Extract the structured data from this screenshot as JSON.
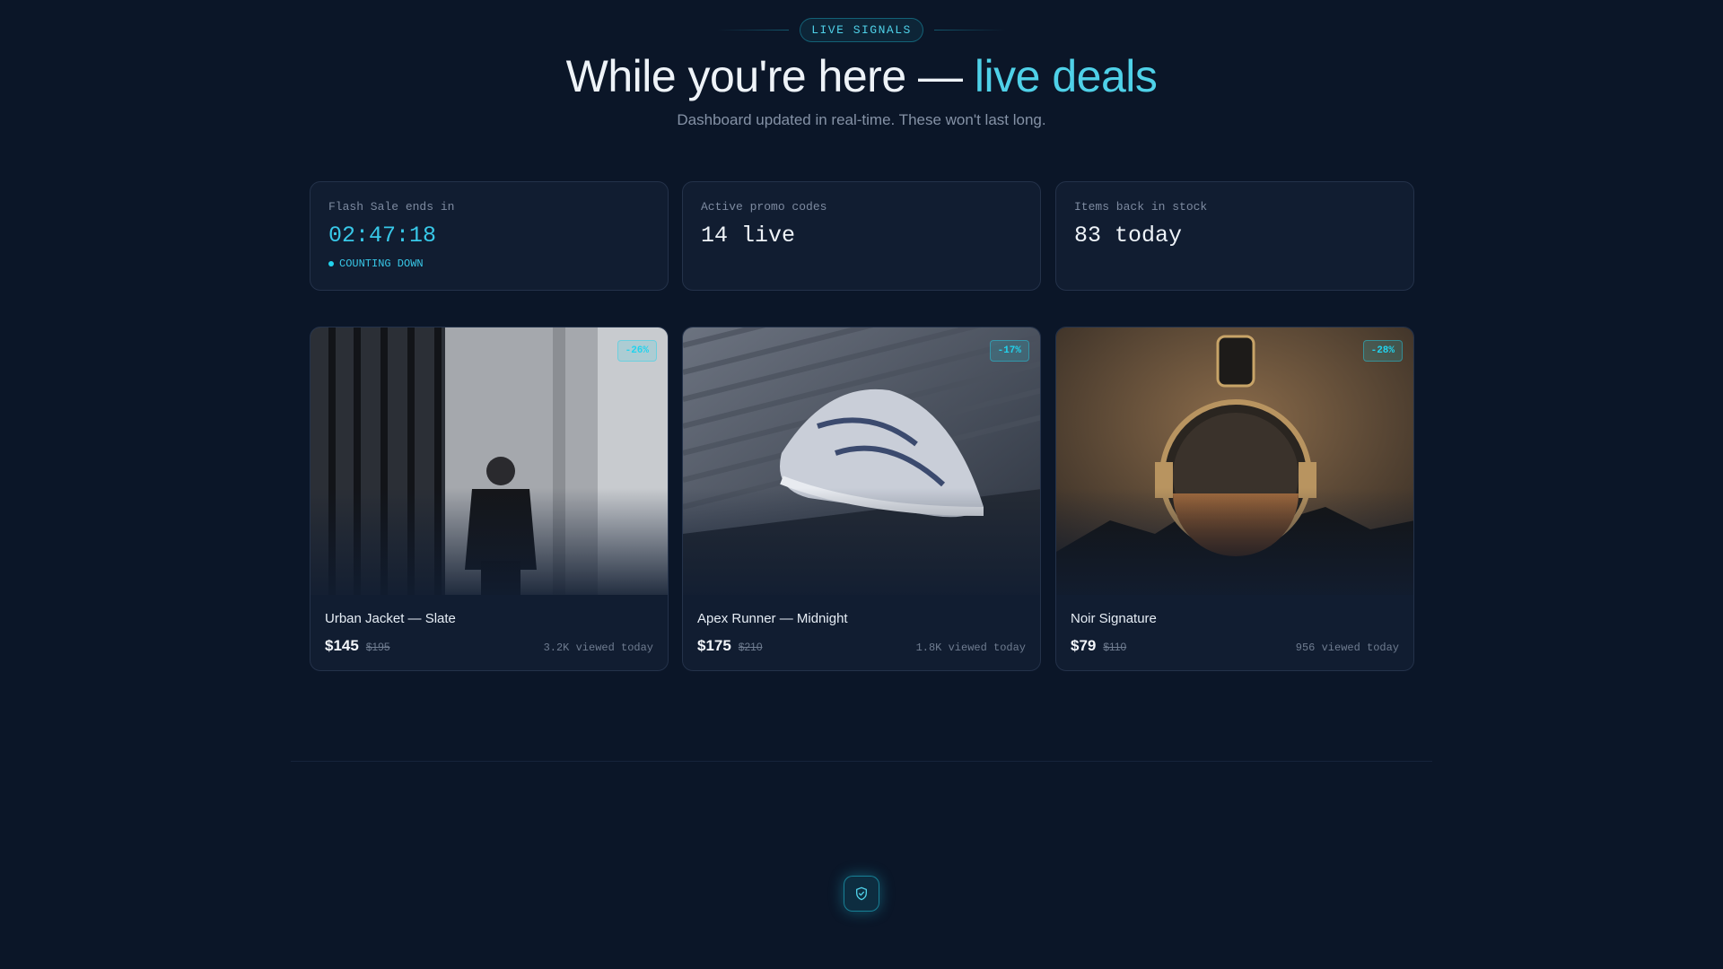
{
  "header": {
    "eyebrow": "LIVE SIGNALS",
    "headline_main": "While you're here — ",
    "headline_accent": "live deals",
    "subhead": "Dashboard updated in real-time. These won't last long."
  },
  "stats": [
    {
      "label": "Flash Sale ends in",
      "value": "02:47:18",
      "status": "COUNTING DOWN"
    },
    {
      "label": "Active promo codes",
      "value": "14 live"
    },
    {
      "label": "Items back in stock",
      "value": "83 today"
    }
  ],
  "products": [
    {
      "title": "Urban Jacket — Slate",
      "price": "$145",
      "was": "$195",
      "views": "3.2K viewed today",
      "badge": "-26%",
      "image": "man-in-jacket-photo"
    },
    {
      "title": "Apex Runner — Midnight",
      "price": "$175",
      "was": "$210",
      "views": "1.8K viewed today",
      "badge": "-17%",
      "image": "sneaker-photo"
    },
    {
      "title": "Noir Signature",
      "price": "$79",
      "was": "$110",
      "views": "956 viewed today",
      "badge": "-28%",
      "image": "perfume-bottle-photo"
    }
  ],
  "icons": {
    "footer": "shield-check-icon"
  },
  "colors": {
    "background": "#0b1628",
    "accent": "#22d3ee",
    "card": "#111d31"
  }
}
